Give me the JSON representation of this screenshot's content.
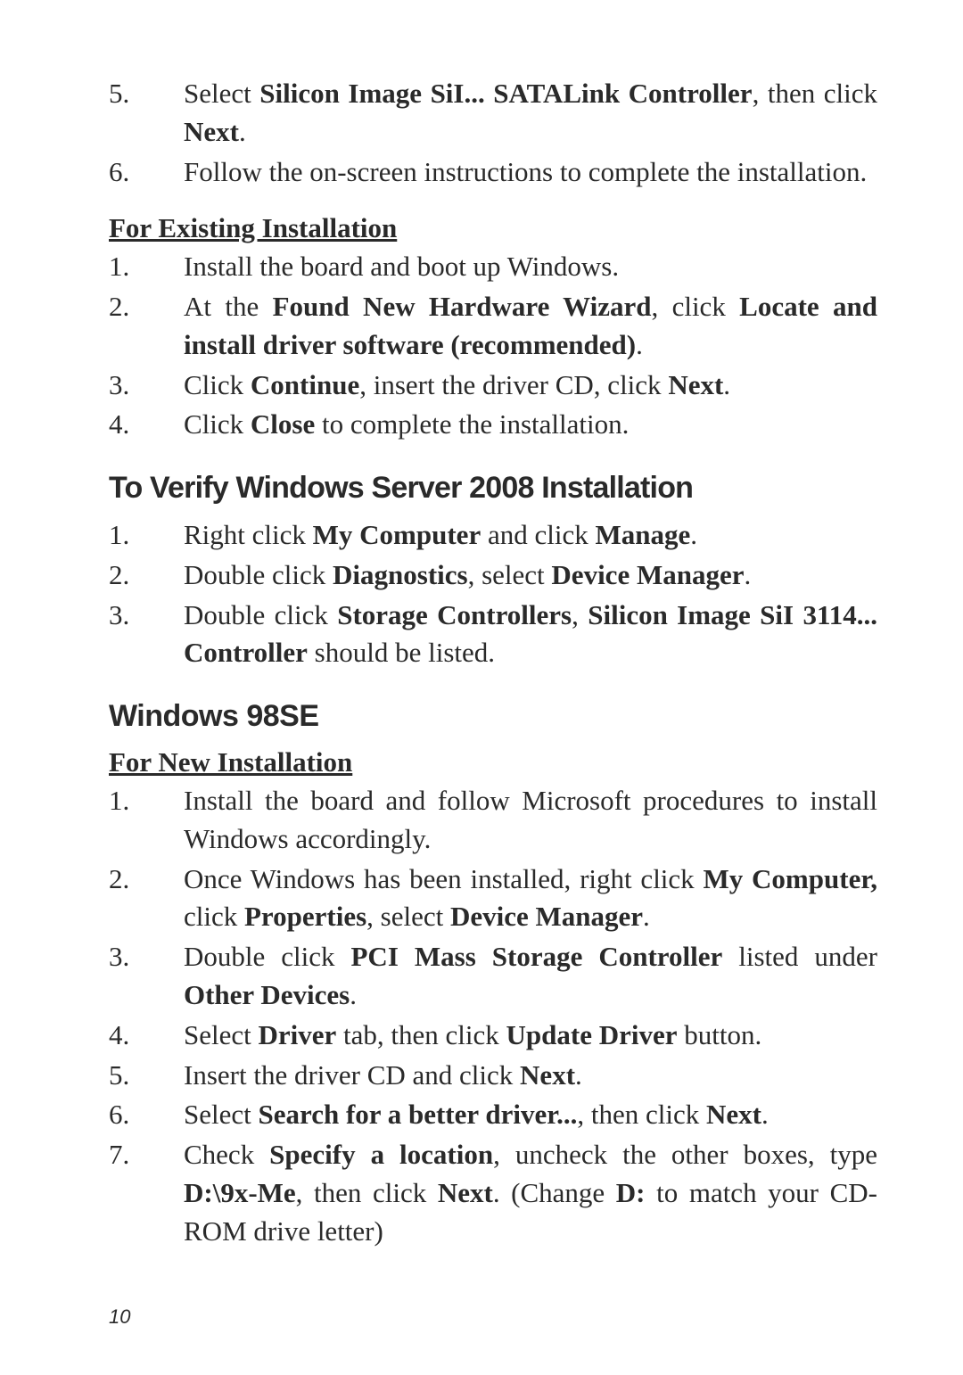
{
  "topList": [
    {
      "num": "5.",
      "html": "Select <b>Silicon Image SiI... SATALink Controller</b>, then click <b>Next</b>."
    },
    {
      "num": "6.",
      "html": "Follow the on-screen instructions to complete the installation."
    }
  ],
  "subhead1": "For Existing Installation",
  "existingList": [
    {
      "num": "1.",
      "html": "Install the board and boot up Windows."
    },
    {
      "num": "2.",
      "html": "At the <b>Found New Hardware Wizard</b>, click <b>Locate and install driver software (recommended)</b>."
    },
    {
      "num": "3.",
      "html": "Click <b>Continue</b>, insert the driver CD, click <b>Next</b>."
    },
    {
      "num": "4.",
      "html": "Click <b>Close</b> to complete the installation."
    }
  ],
  "h2a": "To Verify Windows Server 2008 Installation",
  "verifyList": [
    {
      "num": "1.",
      "html": "Right click <b>My Computer</b> and click <b>Manage</b>."
    },
    {
      "num": "2.",
      "html": "Double click <b>Diagnostics</b>, select <b>Device Manager</b>."
    },
    {
      "num": "3.",
      "html": "Double click <b>Storage Controllers</b>, <b>Silicon Image SiI 3114... Controller</b> should be listed."
    }
  ],
  "h2b": "Windows 98SE",
  "subhead2": "For New Installation",
  "newInstallList": [
    {
      "num": "1.",
      "html": "Install the board and follow Microsoft procedures to install Windows accordingly."
    },
    {
      "num": "2.",
      "html": "Once Windows has been installed, right click <b>My Computer,</b> click <b>Properties</b>, select <b>Device Manager</b>."
    },
    {
      "num": "3.",
      "html": "Double click <b>PCI Mass Storage Controller</b> listed under <b>Other Devices</b>."
    },
    {
      "num": "4.",
      "html": "Select <b>Driver</b> tab, then click <b>Update Driver</b> button."
    },
    {
      "num": "5.",
      "html": "Insert the driver CD and click <b>Next</b>."
    },
    {
      "num": "6.",
      "html": "Select <b>Search for a better driver...</b>, then click <b>Next</b>."
    },
    {
      "num": "7.",
      "html": "Check <b>Specify a location</b>, uncheck the other boxes, type <b>D:\\9x-Me</b>, then click <b>Next</b>.  (Change <b>D:</b> to match your CD-ROM drive letter)"
    }
  ],
  "pageNumber": "10"
}
